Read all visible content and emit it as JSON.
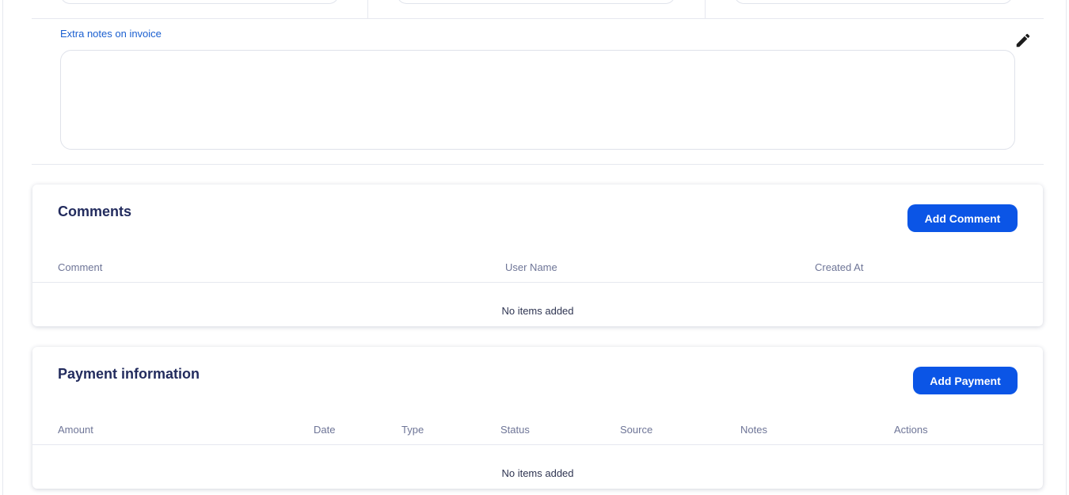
{
  "notes": {
    "label": "Extra notes on invoice",
    "value": "",
    "edit_icon": "pencil-icon"
  },
  "comments": {
    "title": "Comments",
    "add_label": "Add Comment",
    "columns": [
      "Comment",
      "User Name",
      "Created At"
    ],
    "empty": "No items added"
  },
  "payments": {
    "title": "Payment information",
    "add_label": "Add Payment",
    "columns": [
      "Amount",
      "Date",
      "Type",
      "Status",
      "Source",
      "Notes",
      "Actions"
    ],
    "empty": "No items added"
  },
  "colors": {
    "accent": "#0b55e6",
    "heading": "#232c5e",
    "label_link": "#1a5fd0",
    "muted": "#6e7597"
  }
}
